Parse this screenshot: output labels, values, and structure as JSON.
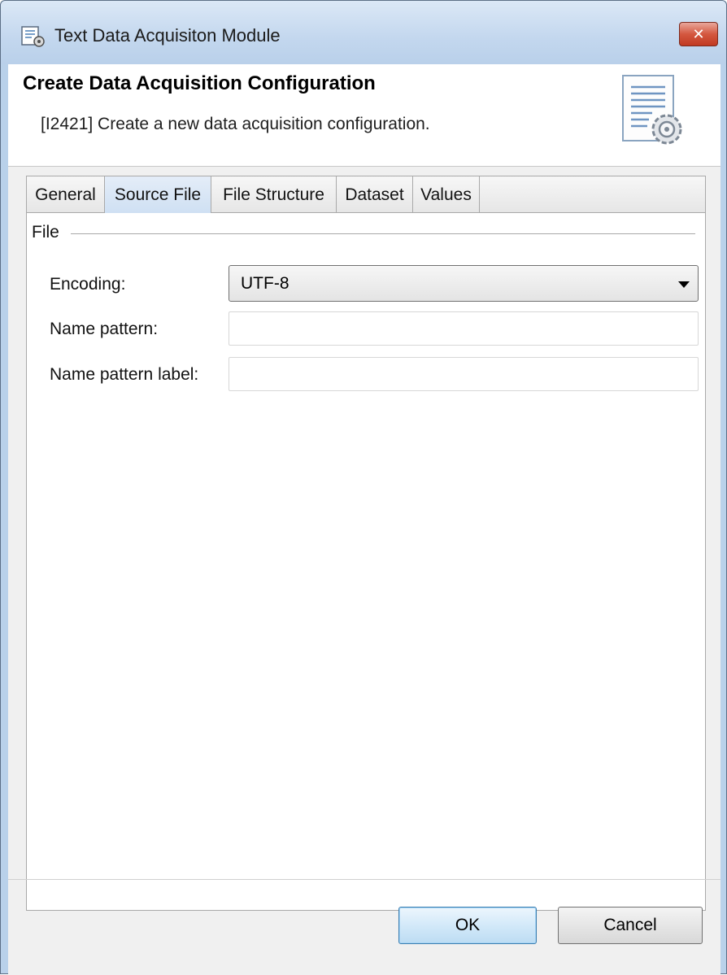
{
  "window": {
    "title": "Text Data Acquisiton Module",
    "close_glyph": "✕",
    "icon": "module-gear-icon"
  },
  "header": {
    "title": "Create Data Acquisition Configuration",
    "description": "[I2421] Create a new data acquisition configuration.",
    "image": "document-gear-icon"
  },
  "tabs": [
    {
      "label": "General",
      "active": false
    },
    {
      "label": "Source File",
      "active": true
    },
    {
      "label": "File Structure",
      "active": false
    },
    {
      "label": "Dataset",
      "active": false
    },
    {
      "label": "Values",
      "active": false
    }
  ],
  "file_group": {
    "label": "File",
    "encoding": {
      "label": "Encoding:",
      "value": "UTF-8"
    },
    "name_pattern": {
      "label": "Name pattern:",
      "value": ""
    },
    "name_pattern_label": {
      "label": "Name pattern label:",
      "value": ""
    }
  },
  "buttons": {
    "ok": "OK",
    "cancel": "Cancel"
  },
  "colors": {
    "window_frame": "#b9d1ea",
    "close_button": "#c13a22",
    "ok_button_border": "#3c7fb1",
    "active_tab": "#cfe0f3"
  }
}
